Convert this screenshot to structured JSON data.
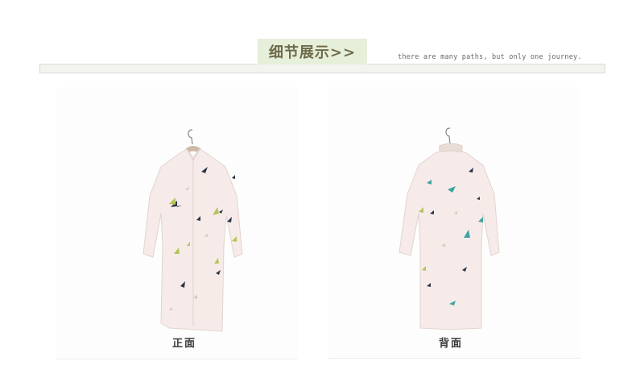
{
  "header": {
    "title": "细节展示>>",
    "tagline": "there are many paths, but only one journey."
  },
  "color_label": "粉红",
  "views": [
    {
      "caption": "正面"
    },
    {
      "caption": "背面"
    }
  ],
  "colors": {
    "garment": "#f6ebe8",
    "accent_green": "#e6efd9",
    "bird_dark": "#2a3448",
    "bird_green": "#b6c45a",
    "bird_teal": "#3aa6a3"
  }
}
